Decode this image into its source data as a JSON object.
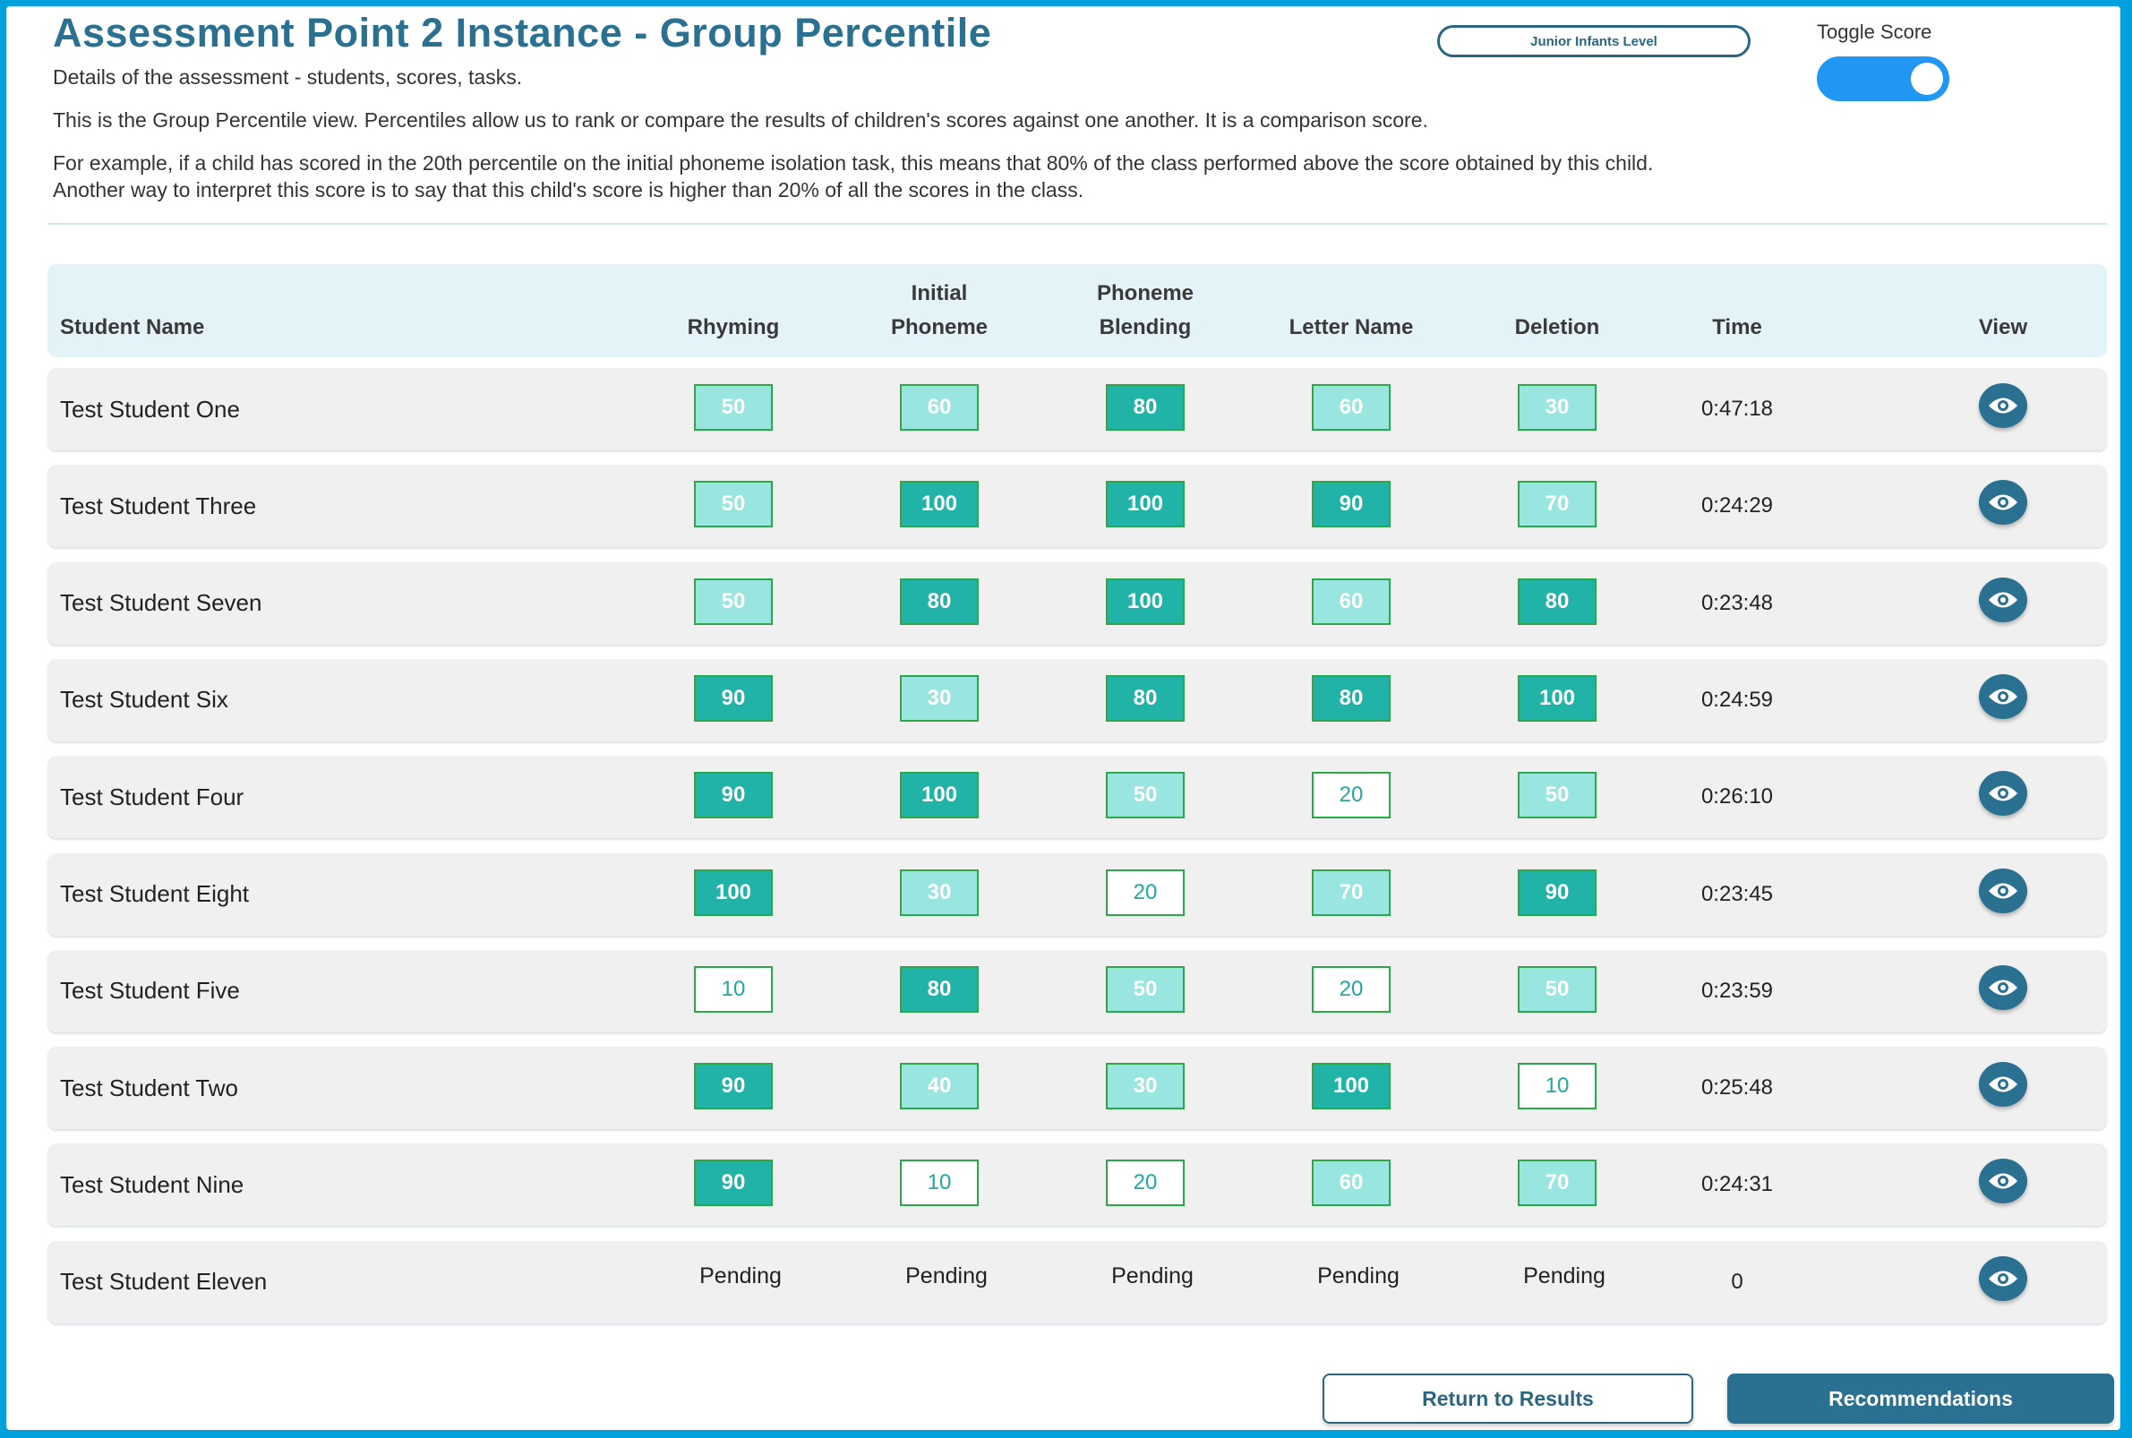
{
  "header": {
    "title": "Assessment Point 2 Instance - Group Percentile",
    "subtitle": "Details of the assessment - students, scores, tasks.",
    "intro": "This is the Group Percentile view. Percentiles allow us to rank or compare the results of children's scores against one another. It is a comparison score.",
    "example_line1": "For example, if a child has scored in the 20th percentile on the initial phoneme isolation task, this means that 80% of the class performed above the score obtained by this child.",
    "example_line2": "Another way to interpret this score is to say that this child's score is higher than 20% of all the scores in the class.",
    "level_button": "Junior Infants Level",
    "toggle_label": "Toggle Score",
    "toggle_on": true
  },
  "colors": {
    "high": "#22b3a8",
    "mid": "#98e6df",
    "low": "#ffffff",
    "accent": "#2a7090",
    "toggle": "#2196f3"
  },
  "table": {
    "columns": [
      {
        "line1": "",
        "line2": "Student Name"
      },
      {
        "line1": "",
        "line2": "Rhyming"
      },
      {
        "line1": "Initial",
        "line2": "Phoneme"
      },
      {
        "line1": "Phoneme",
        "line2": "Blending"
      },
      {
        "line1": "",
        "line2": "Letter Name"
      },
      {
        "line1": "",
        "line2": "Deletion"
      },
      {
        "line1": "",
        "line2": "Time"
      },
      {
        "line1": "",
        "line2": "View"
      }
    ],
    "rows": [
      {
        "name": "Test Student One",
        "scores": [
          "50",
          "60",
          "80",
          "60",
          "30"
        ],
        "time": "0:47:18"
      },
      {
        "name": "Test Student Three",
        "scores": [
          "50",
          "100",
          "100",
          "90",
          "70"
        ],
        "time": "0:24:29"
      },
      {
        "name": "Test Student Seven",
        "scores": [
          "50",
          "80",
          "100",
          "60",
          "80"
        ],
        "time": "0:23:48"
      },
      {
        "name": "Test Student Six",
        "scores": [
          "90",
          "30",
          "80",
          "80",
          "100"
        ],
        "time": "0:24:59"
      },
      {
        "name": "Test Student Four",
        "scores": [
          "90",
          "100",
          "50",
          "20",
          "50"
        ],
        "time": "0:26:10"
      },
      {
        "name": "Test Student Eight",
        "scores": [
          "100",
          "30",
          "20",
          "70",
          "90"
        ],
        "time": "0:23:45"
      },
      {
        "name": "Test Student Five",
        "scores": [
          "10",
          "80",
          "50",
          "20",
          "50"
        ],
        "time": "0:23:59"
      },
      {
        "name": "Test Student Two",
        "scores": [
          "90",
          "40",
          "30",
          "100",
          "10"
        ],
        "time": "0:25:48"
      },
      {
        "name": "Test Student Nine",
        "scores": [
          "90",
          "10",
          "20",
          "60",
          "70"
        ],
        "time": "0:24:31"
      },
      {
        "name": "Test Student Eleven",
        "scores": [
          "Pending",
          "Pending",
          "Pending",
          "Pending",
          "Pending"
        ],
        "time": "0"
      }
    ]
  },
  "footer": {
    "return_label": "Return to Results",
    "recommendations_label": "Recommendations"
  }
}
